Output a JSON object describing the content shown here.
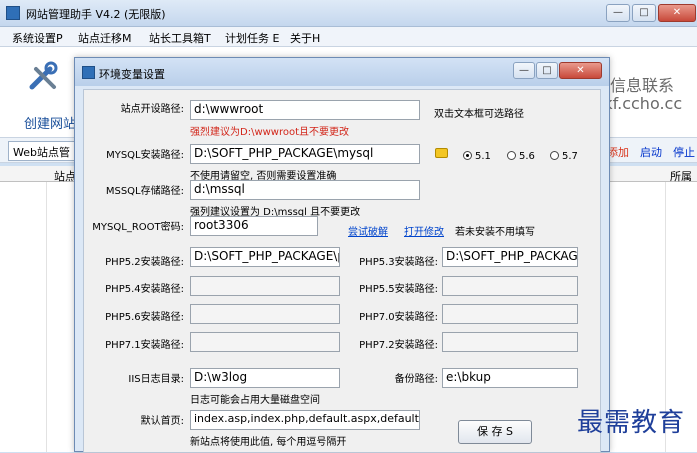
{
  "main_window": {
    "title": "网站管理助手 V4.2 (无限版)",
    "window_buttons": {
      "minimize": "—",
      "maximize": "□",
      "close": "✕"
    }
  },
  "menubar": {
    "items": [
      "系统设置P",
      "站点迁移M",
      "站长工具箱T",
      "计划任务 E",
      "关于H"
    ]
  },
  "toolbar": {
    "create_site": "创建网站",
    "info_contact": "信息联系",
    "info_site": "/kf.ccho.cc"
  },
  "tabbar": {
    "tab": "Web站点管",
    "actions": [
      "添加",
      "启动",
      "停止"
    ]
  },
  "grid": {
    "headers": [
      "站点",
      "所属"
    ]
  },
  "dialog": {
    "title": "环境变量设置",
    "window_buttons": {
      "minimize": "—",
      "maximize": "□",
      "close": "✕"
    },
    "site_path_label": "站点开设路径:",
    "site_path_value": "d:\\wwwroot",
    "site_path_hint": "双击文本框可选路径",
    "site_path_warning": "强烈建议为D:\\wwwroot且不要更改",
    "mysql_path_label": "MYSQL安装路径:",
    "mysql_path_value": "D:\\SOFT_PHP_PACKAGE\\mysql",
    "mysql_note": "不使用请留空, 否则需要设置准确",
    "mysql_versions": [
      "5.1",
      "5.6",
      "5.7"
    ],
    "mysql_selected": "5.1",
    "mssql_path_label": "MSSQL存储路径:",
    "mssql_path_value": "d:\\mssql",
    "mssql_note": "强列建议设置为 D:\\mssql 且不要更改",
    "mysql_root_label": "MYSQL_ROOT密码:",
    "mysql_root_value": "root3306",
    "link_test": "尝试破解",
    "link_open": "打开修改",
    "root_note": "若未安装不用填写",
    "php52_label": "PHP5.2安装路径:",
    "php52_value": "D:\\SOFT_PHP_PACKAGE\\p",
    "php53_label": "PHP5.3安装路径:",
    "php53_value": "D:\\SOFT_PHP_PACKAGI",
    "php54_label": "PHP5.4安装路径:",
    "php54_value": "",
    "php55_label": "PHP5.5安装路径:",
    "php55_value": "",
    "php56_label": "PHP5.6安装路径:",
    "php56_value": "",
    "php70_label": "PHP7.0安装路径:",
    "php70_value": "",
    "php71_label": "PHP7.1安装路径:",
    "php71_value": "",
    "php72_label": "PHP7.2安装路径:",
    "php72_value": "",
    "iis_log_label": "IIS日志目录:",
    "iis_log_value": "D:\\w3log",
    "iis_log_note": "日志可能会占用大量磁盘空间",
    "backup_label": "备份路径:",
    "backup_value": "e:\\bkup",
    "default_page_label": "默认首页:",
    "default_page_value": "index.asp,index.php,default.aspx,default.",
    "default_page_note": "新站点将使用此值, 每个用逗号隔开",
    "save_label": "保 存 S"
  },
  "watermark": "最需教育"
}
